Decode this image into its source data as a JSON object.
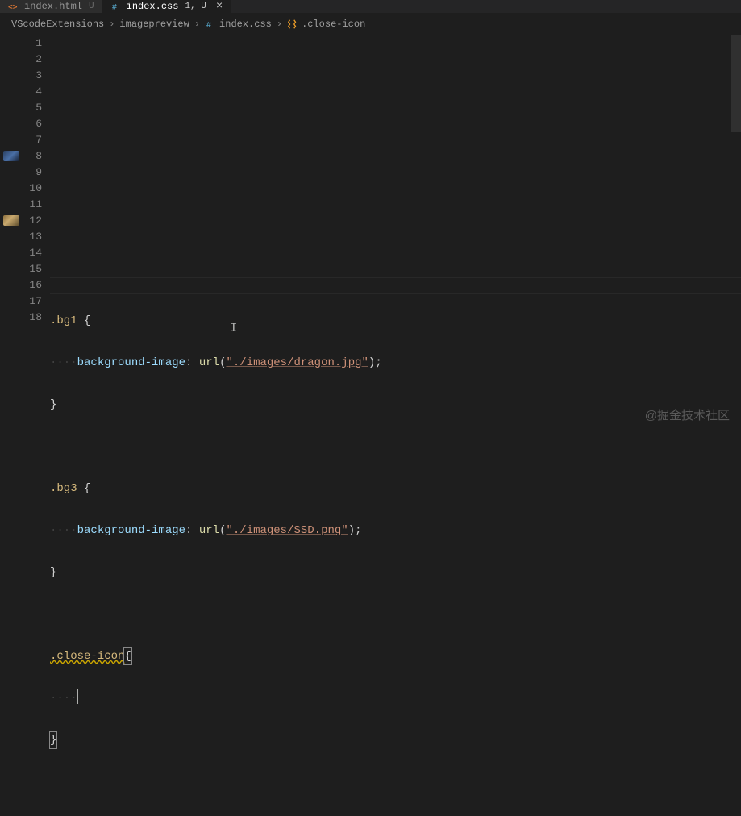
{
  "tabs": [
    {
      "name": "index.html",
      "status": "U",
      "active": false,
      "iconColor": "#e37933"
    },
    {
      "name": "index.css",
      "status": "1, U",
      "active": true,
      "iconColor": "#519aba"
    }
  ],
  "breadcrumbs": [
    {
      "label": "VScodeExtensions",
      "icon": null
    },
    {
      "label": "imagepreview",
      "icon": null
    },
    {
      "label": "index.css",
      "icon": "css"
    },
    {
      "label": ".close-icon",
      "icon": "symbol"
    }
  ],
  "lineNumbers": [
    "1",
    "2",
    "3",
    "4",
    "5",
    "6",
    "7",
    "8",
    "9",
    "10",
    "11",
    "12",
    "13",
    "14",
    "15",
    "16",
    "17",
    "18"
  ],
  "code": {
    "bg1": {
      "selector": ".bg1",
      "prop": "background-image",
      "func": "url",
      "path": "\"./images/dragon.jpg\""
    },
    "bg3": {
      "selector": ".bg3",
      "prop": "background-image",
      "func": "url",
      "path": "\"./images/SSD.png\""
    },
    "close": {
      "selector": ".close-icon"
    },
    "brace_open": "{",
    "brace_close": "}",
    "paren_open": "(",
    "paren_close": ")",
    "semi": ";",
    "colon": ":",
    "ws4": "····"
  },
  "currentLine": 16,
  "watermark": "@掘金技术社区"
}
